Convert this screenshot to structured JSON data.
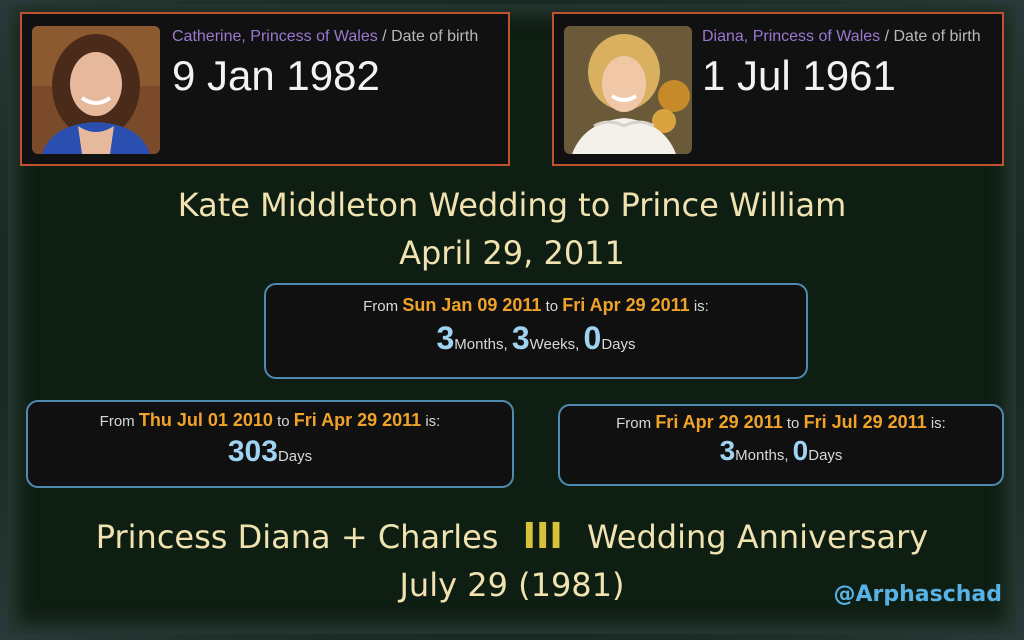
{
  "cards": [
    {
      "name": "Catherine, Princess of Wales",
      "sep": " / ",
      "field": "Date of birth",
      "date": "9 Jan 1982"
    },
    {
      "name": "Diana, Princess of Wales",
      "sep": " / ",
      "field": "Date of birth",
      "date": "1 Jul 1961"
    }
  ],
  "headline": {
    "line1": "Kate Middleton Wedding to Prince William",
    "line2": "April 29, 2011"
  },
  "boxes": {
    "top": {
      "from": "From",
      "start": "Sun Jan 09 2011",
      "to": "to",
      "end": "Fri Apr 29 2011",
      "is": "is:",
      "v1": "3",
      "u1": "Months,",
      "v2": "3",
      "u2": "Weeks,",
      "v3": "0",
      "u3": "Days"
    },
    "left": {
      "from": "From",
      "start": "Thu Jul 01 2010",
      "to": "to",
      "end": "Fri Apr 29 2011",
      "is": "is:",
      "v1": "303",
      "u1": "Days"
    },
    "right": {
      "from": "From",
      "start": "Fri Apr 29 2011",
      "to": "to",
      "end": "Fri Jul 29 2011",
      "is": "is:",
      "v1": "3",
      "u1": "Months,",
      "v2": "0",
      "u2": "Days"
    }
  },
  "footer": {
    "line1a": "Princess Diana + Charles",
    "roman": "III",
    "line1b": "Wedding Anniversary",
    "line2": "July 29 (1981)"
  },
  "handle": "@Arphaschad",
  "colors": {
    "card_border": "#c0532e",
    "box_border": "#4f8bb0",
    "date_orange": "#f0a32a",
    "number_blue": "#9fd3f2",
    "title_cream": "#f1e3b0",
    "name_purple": "#9a78d0",
    "roman_gold": "#d8c23a",
    "handle_blue": "#58b2e6"
  }
}
